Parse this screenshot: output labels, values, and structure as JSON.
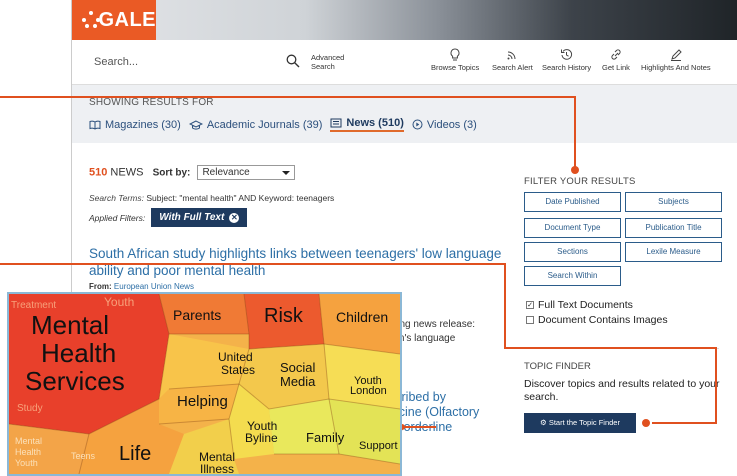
{
  "app": {
    "logo_text": "GALE"
  },
  "toolbar": {
    "search_placeholder": "Search...",
    "advanced_line1": "Advanced",
    "advanced_line2": "Search",
    "tools": [
      {
        "label": "Browse Topics",
        "icon": "lightbulb-icon"
      },
      {
        "label": "Search Alert",
        "icon": "rss-icon"
      },
      {
        "label": "Search History",
        "icon": "history-icon"
      },
      {
        "label": "Get Link",
        "icon": "link-icon"
      },
      {
        "label": "Highlights And Notes",
        "icon": "pen-icon"
      }
    ]
  },
  "results": {
    "showing_label": "SHOWING RESULTS FOR",
    "tabs": [
      {
        "label": "Magazines (30)",
        "icon": "book-icon",
        "active": false
      },
      {
        "label": "Academic Journals (39)",
        "icon": "mortarboard-icon",
        "active": false
      },
      {
        "label": "News (510)",
        "icon": "newspaper-icon",
        "active": true
      },
      {
        "label": "Videos (3)",
        "icon": "play-icon",
        "active": false
      }
    ],
    "count": "510",
    "count_label": "NEWS",
    "sort_label": "Sort by:",
    "sort_value": "Relevance",
    "search_terms_label": "Search Terms:",
    "search_terms_value": "Subject: \"mental health\" AND Keyword: teenagers",
    "applied_filters_label": "Applied Filters:",
    "applied_filter": "With Full Text",
    "headline": "South African study highlights links between teenagers' low language ability and poor mental health",
    "from_label": "From:",
    "from_source": "European Union News",
    "snippet_line1": "wing news release:",
    "snippet_line2": "ren's language",
    "headline2_line1": "scribed by",
    "headline2_line2": "dicine (Olfactory",
    "headline2_line3": "r borderline"
  },
  "filters": {
    "title": "FILTER YOUR RESULTS",
    "buttons": [
      "Date Published",
      "Subjects",
      "Document Type",
      "Publication Title",
      "Sections",
      "Lexile Measure",
      "Search Within"
    ],
    "checks": [
      {
        "label": "Full Text Documents",
        "checked": true
      },
      {
        "label": "Document Contains Images",
        "checked": false
      }
    ]
  },
  "topic_finder": {
    "title": "TOPIC FINDER",
    "description": "Discover topics and results related to your search.",
    "button": "Start the Topic Finder"
  },
  "topic_wheel": {
    "cells": [
      "Mental",
      "Health",
      "Services",
      "Parents",
      "Risk",
      "Children",
      "United",
      "States",
      "Social",
      "Media",
      "Youth",
      "London",
      "Helping",
      "Youth",
      "Byline",
      "Family",
      "Support",
      "Life",
      "Mental",
      "Illness",
      "Treatment",
      "Youth",
      "Study",
      "Mental",
      "Health",
      "Youth",
      "Teens"
    ]
  },
  "colors": {
    "accent": "#e0501f",
    "brand_orange": "#ea5a25",
    "navy": "#1e3a5f",
    "link": "#2d6fa6"
  }
}
